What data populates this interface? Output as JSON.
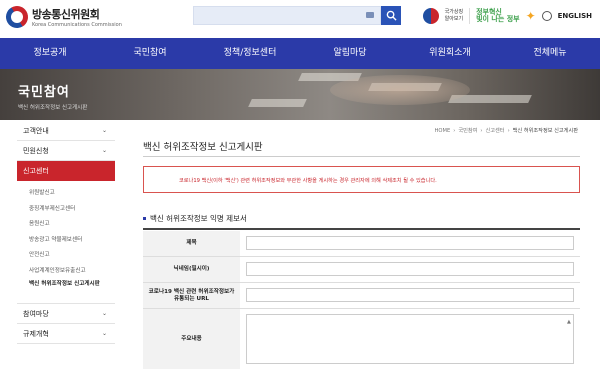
{
  "header": {
    "logo_name": "방송통신위원회",
    "logo_sub": "Korea Communications Commission",
    "right_logo1_line1": "국가상징",
    "right_logo1_line2": "알아보기",
    "right_logo2_line1": "정부혁신",
    "right_logo2_line2": "빛이 나는 정부",
    "english_label": "ENGLISH"
  },
  "nav": [
    "정보공개",
    "국민참여",
    "정책/정보센터",
    "알림마당",
    "위원회소개",
    "전체메뉴"
  ],
  "banner": {
    "title": "국민참여",
    "subtitle": "백신 허위조작정보 신고게시판"
  },
  "sidebar": {
    "items": [
      {
        "label": "고객안내",
        "chevron": "⌄"
      },
      {
        "label": "민원신청",
        "chevron": "⌄"
      },
      {
        "label": "신고센터",
        "chevron": ""
      }
    ],
    "sub_items": [
      "위원발신고",
      "중징계부제신고센터",
      "음원신고",
      "방송광고 약물제보센터",
      "안전신고",
      "사업계계인정보유출신고",
      "백신 허위조작정보 신고게시판"
    ],
    "bottom_items": [
      {
        "label": "참여마당",
        "chevron": "⌄"
      },
      {
        "label": "규제개혁",
        "chevron": "⌄"
      }
    ]
  },
  "breadcrumb": [
    "HOME",
    "국민참여",
    "신고센터",
    "백신 허위조작정보 신고게시판"
  ],
  "page_title": "백신 허위조작정보 신고게시판",
  "notice": "코로나19 백신(이하 '백신') 관련 허위조작정보와 무관한 사항을 게시하는 경우 관리자에 의해 삭제조치 될 수 있습니다.",
  "form": {
    "title": "백신 허위조작정보 익명 제보서",
    "fields": [
      {
        "label": "제목"
      },
      {
        "label": "닉네임(필시이)"
      },
      {
        "label": "코로나19 백신 관련 허위조작정보가 유통되는 URL"
      },
      {
        "label": "주요내용"
      }
    ]
  }
}
